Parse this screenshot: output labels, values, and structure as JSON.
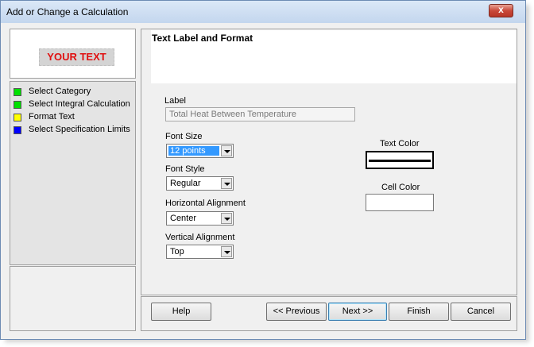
{
  "window": {
    "title": "Add or Change a Calculation",
    "close_glyph": "x"
  },
  "preview": {
    "text": "YOUR TEXT",
    "text_color": "#e01010"
  },
  "steps": [
    {
      "label": "Select Category",
      "color": "#00e000"
    },
    {
      "label": "Select Integral Calculation",
      "color": "#00e000"
    },
    {
      "label": "Format Text",
      "color": "#ffff00"
    },
    {
      "label": "Select Specification Limits",
      "color": "#0000ff"
    }
  ],
  "panel": {
    "title": "Text Label and Format",
    "label_caption": "Label",
    "label_value": "Total Heat Between Temperature",
    "font_size_caption": "Font Size",
    "font_size_value": "12 points",
    "font_style_caption": "Font Style",
    "font_style_value": "Regular",
    "h_align_caption": "Horizontal Alignment",
    "h_align_value": "Center",
    "v_align_caption": "Vertical Alignment",
    "v_align_value": "Top",
    "text_color_caption": "Text Color",
    "text_color_value": "#000000",
    "cell_color_caption": "Cell Color",
    "cell_color_value": "#ffffff"
  },
  "buttons": {
    "help": "Help",
    "previous": "<< Previous",
    "next": "Next >>",
    "finish": "Finish",
    "cancel": "Cancel"
  }
}
